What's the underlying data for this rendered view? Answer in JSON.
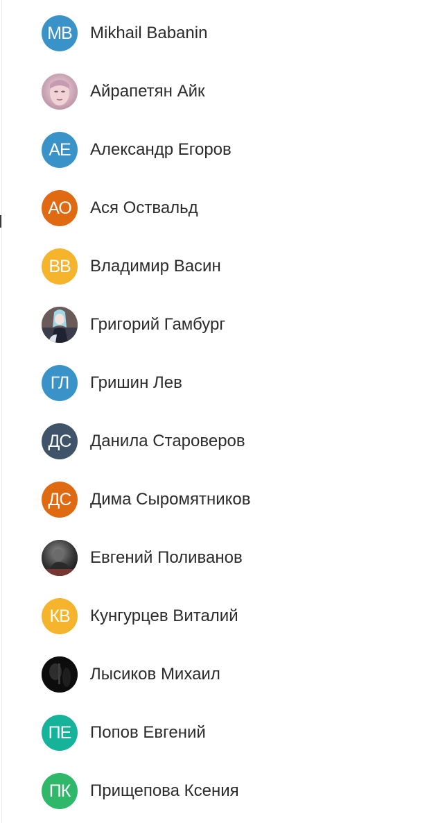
{
  "contacts": [
    {
      "name": "Mikhail Babanin",
      "initials": "MB",
      "color": "#3a93c8",
      "photo": false
    },
    {
      "name": "Айрапетян Айк",
      "initials": "",
      "color": "#d9b9c8",
      "photo": true,
      "photo_icon": "face-photo-pink"
    },
    {
      "name": "Александр Егоров",
      "initials": "АЕ",
      "color": "#3a93c8",
      "photo": false
    },
    {
      "name": "Ася Оствальд",
      "initials": "АО",
      "color": "#e06a12",
      "photo": false
    },
    {
      "name": "Владимир Васин",
      "initials": "ВВ",
      "color": "#f6b42c",
      "photo": false
    },
    {
      "name": "Григорий Гамбург",
      "initials": "",
      "color": "#5a5050",
      "photo": true,
      "photo_icon": "anime-character-photo"
    },
    {
      "name": "Гришин Лев",
      "initials": "ГЛ",
      "color": "#3a93c8",
      "photo": false
    },
    {
      "name": "Данила Староверов",
      "initials": "ДС",
      "color": "#3f5468",
      "photo": false
    },
    {
      "name": "Дима Сыромятников",
      "initials": "ДС",
      "color": "#e06a12",
      "photo": false
    },
    {
      "name": "Евгений Поливанов",
      "initials": "",
      "color": "#2a2a2a",
      "photo": true,
      "photo_icon": "dark-figure-photo"
    },
    {
      "name": "Кунгурцев Виталий",
      "initials": "КВ",
      "color": "#f6b42c",
      "photo": false
    },
    {
      "name": "Лысиков Михаил",
      "initials": "",
      "color": "#111111",
      "photo": true,
      "photo_icon": "dark-photo"
    },
    {
      "name": "Попов Евгений",
      "initials": "ПЕ",
      "color": "#17b29a",
      "photo": false
    },
    {
      "name": "Прищепова Ксения",
      "initials": "ПК",
      "color": "#2fb86a",
      "photo": false
    }
  ]
}
